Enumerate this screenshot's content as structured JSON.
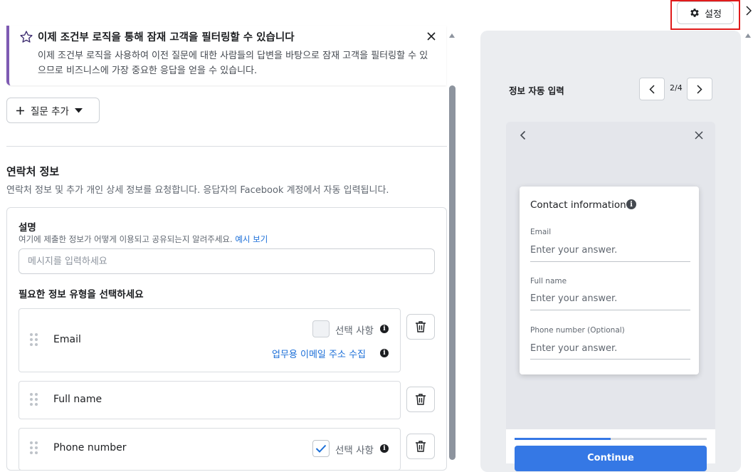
{
  "header": {
    "settings_label": "설정",
    "settings_icon": "gear-icon"
  },
  "banner": {
    "icon": "star-icon",
    "title": "이제 조건부 로직을 통해 잠재 고객을 필터링할 수 있습니다",
    "description": "이제 조건부 로직을 사용하여 이전 질문에 대한 사람들의 답변을 바탕으로 잠재 고객을 필터링할 수 있으므로 비즈니스에 가장 중요한 응답을 얻을 수 있습니다.",
    "accent_color": "#7e5bb3"
  },
  "toolbar": {
    "add_question_label": "질문 추가"
  },
  "section": {
    "title": "연락처 정보",
    "description": "연락처 정보 및 추가 개인 상세 정보를 요청합니다. 응답자의 Facebook 계정에서 자동 입력됩니다."
  },
  "card": {
    "description_label": "설명",
    "description_help": "여기에 제출한 정보가 어떻게 이용되고 공유되는지 알려주세요.",
    "description_help_link": "예시 보기",
    "message_placeholder": "메시지를 입력하세요",
    "type_label": "필요한 정보 유형을 선택하세요",
    "fields": [
      {
        "name": "Email",
        "optional_label": "선택 사항",
        "optional_checked": false,
        "work_email_label": "업무용 이메일 주소 수집"
      },
      {
        "name": "Full name"
      },
      {
        "name": "Phone number",
        "optional_label": "선택 사항",
        "optional_checked": true
      }
    ]
  },
  "preview": {
    "title": "정보 자동 입력",
    "page_indicator": "2/4",
    "form": {
      "title": "Contact information",
      "fields": [
        {
          "label": "Email",
          "placeholder": "Enter your answer."
        },
        {
          "label": "Full name",
          "placeholder": "Enter your answer."
        },
        {
          "label": "Phone number (Optional)",
          "placeholder": "Enter your answer."
        }
      ],
      "progress": 0.5,
      "continue_label": "Continue",
      "accent_color": "#3578e5"
    }
  }
}
